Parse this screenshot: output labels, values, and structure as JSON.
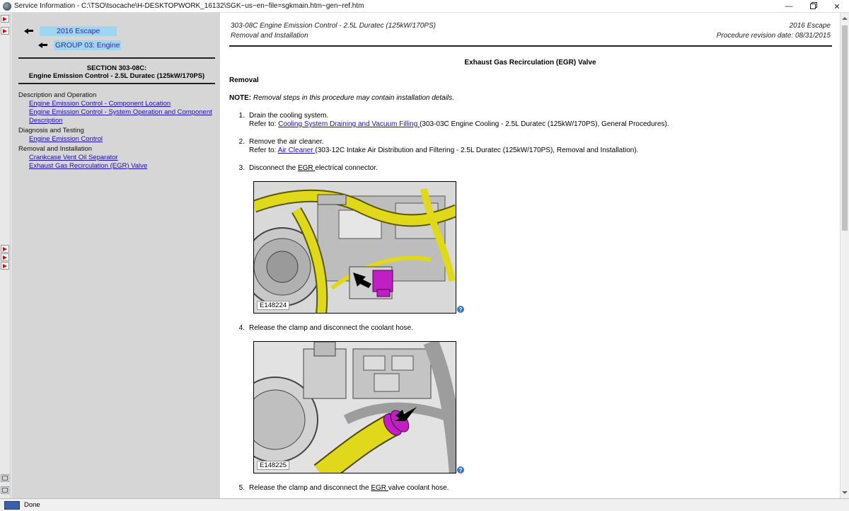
{
  "window": {
    "title": "Service Information - C:\\TSO\\tsocache\\H-DESKTOPWORK_16132\\SGK~us~en~file=sgkmain.htm~gen~ref.htm",
    "min_glyph": "—",
    "close_glyph": "✕"
  },
  "nav": {
    "back_vehicle": "2016 Escape",
    "back_group": "GROUP 03: Engine",
    "section_line1": "SECTION 303-08C:",
    "section_line2": "Engine Emission Control - 2.5L Duratec (125kW/170PS)",
    "tree": {
      "cat1": "Description and Operation",
      "link1": "Engine Emission Control - Component Location",
      "link2": "Engine Emission Control - System Operation and Component Description",
      "cat2": "Diagnosis and Testing",
      "link3": "Engine Emission Control",
      "cat3": "Removal and Installation",
      "link4": "Crankcase Vent Oil Separator",
      "link5": "Exhaust Gas Recirculation (EGR) Valve"
    }
  },
  "doc": {
    "header_left1": "303-08C Engine Emission Control - 2.5L Duratec (125kW/170PS)",
    "header_left2": "Removal and Installation",
    "header_right1": "2016 Escape",
    "header_right2": "Procedure revision date: 08/31/2015",
    "title": "Exhaust Gas Recirculation (EGR) Valve",
    "removal_heading": "Removal",
    "note_label": "NOTE:",
    "note_text": " Removal steps in this procedure may contain installation details.",
    "steps": [
      {
        "num": "1.",
        "text": "Drain the cooling system.",
        "refer": "Refer to: ",
        "link": "Cooling System Draining and Vacuum Filling ",
        "after": "(303-03C Engine Cooling - 2.5L Duratec (125kW/170PS), General Procedures)."
      },
      {
        "num": "2.",
        "text": "Remove the air cleaner.",
        "refer": "Refer to: ",
        "link": "Air Cleaner ",
        "after": "(303-12C Intake Air Distribution and Filtering - 2.5L Duratec (125kW/170PS), Removal and Installation)."
      },
      {
        "num": "3.",
        "pre": "Disconnect the ",
        "abbr": "EGR ",
        "post": "electrical connector."
      },
      {
        "num": "4.",
        "text": "Release the clamp and disconnect the coolant hose."
      },
      {
        "num": "5.",
        "pre": "Release the clamp and disconnect the ",
        "abbr": "EGR ",
        "post": "valve coolant hose."
      }
    ],
    "figure1_label": "E148224",
    "figure2_label": "E148225",
    "help_glyph": "?"
  },
  "status": {
    "text": "Done"
  },
  "colors": {
    "nav_bg": "#d6d6d6",
    "highlight": "#9fd6ef",
    "link": "#1a0dab",
    "hose_yellow": "#e0d81a",
    "connector_magenta": "#c11fc4"
  },
  "icons": {
    "back": "back-arrow-icon",
    "help": "help-icon",
    "nav_buttons": "red-arrow-icon"
  }
}
